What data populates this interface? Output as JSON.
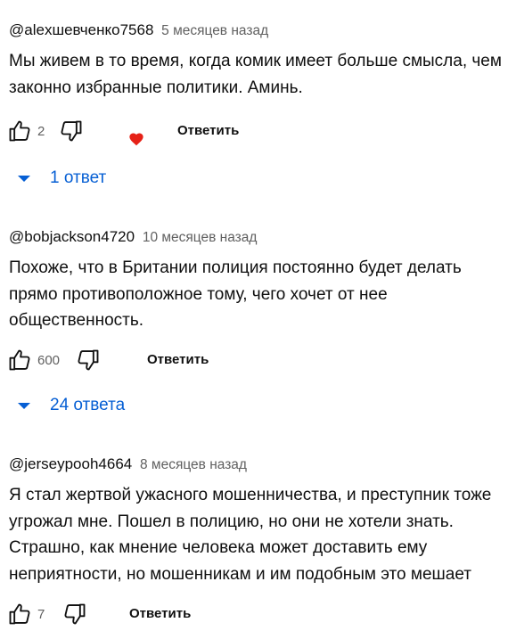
{
  "comments": [
    {
      "author": "@alexшевченко7568",
      "time": "5 месяцев назад",
      "text": "Мы живем в то время, когда комик имеет больше смысла, чем законно избранные политики. Аминь.",
      "likes": "2",
      "reply_label": "Ответить",
      "replies_label": "1 ответ",
      "creator_heart": true
    },
    {
      "author": "@bobjackson4720",
      "time": "10 месяцев назад",
      "text": "Похоже, что в Британии полиция постоянно будет делать прямо противоположное тому, чего хочет от нее общественность.",
      "likes": "600",
      "reply_label": "Ответить",
      "replies_label": "24 ответа"
    },
    {
      "author": "@jerseypooh4664",
      "time": "8 месяцев назад",
      "text": "Я стал жертвой ужасного мошенничества, и преступник тоже угрожал мне. Пошел в полицию, но они не хотели знать. Страшно, как мнение человека может доставить ему неприятности, но мошенникам и им подобным это мешает",
      "likes": "7",
      "reply_label": "Ответить"
    }
  ],
  "colors": {
    "link": "#065fd4",
    "heart": "#e62117",
    "muted": "#606060"
  },
  "icons": {
    "like": "thumbs-up-icon",
    "dislike": "thumbs-down-icon",
    "expand": "caret-down-icon",
    "heart": "heart-icon"
  }
}
